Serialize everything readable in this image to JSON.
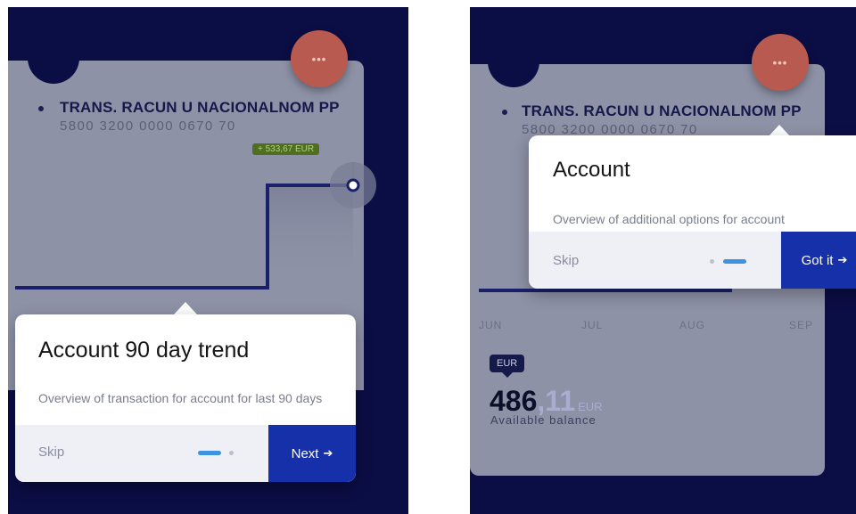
{
  "left": {
    "menu_label": "•••",
    "account_name": "TRANS. RACUN U NACIONALNOM PP",
    "account_number": "5800 3200 0000 0670 70",
    "amount_badge": "+ 533,67  EUR",
    "tooltip": {
      "title": "Account 90 day trend",
      "description": "Overview of transaction for account for last 90 days",
      "skip_label": "Skip",
      "action_label": "Next",
      "action_icon": "arrow-right-icon",
      "step": 1,
      "total_steps": 2
    }
  },
  "right": {
    "menu_label": "•••",
    "account_name": "TRANS. RACUN U NACIONALNOM PP",
    "account_number": "5800 3200 0000 0670 70",
    "months": [
      "JUN",
      "JUL",
      "AUG",
      "SEP"
    ],
    "currency_badge": "EUR",
    "balance_integer": "486",
    "balance_decimal": ",11",
    "balance_currency": "EUR",
    "balance_label": "Available balance",
    "tooltip": {
      "title": "Account",
      "description": "Overview of additional options for account",
      "skip_label": "Skip",
      "action_label": "Got it",
      "action_icon": "arrow-right-icon",
      "step": 2,
      "total_steps": 2
    }
  },
  "colors": {
    "background": "#0b0d45",
    "card": "#8e92a6",
    "menu_button": "#b85a50",
    "chart_line": "#1a1f6b",
    "badge_positive": "#4f6e1f",
    "action_button": "#1530a8",
    "active_dot": "#3e93e0"
  }
}
